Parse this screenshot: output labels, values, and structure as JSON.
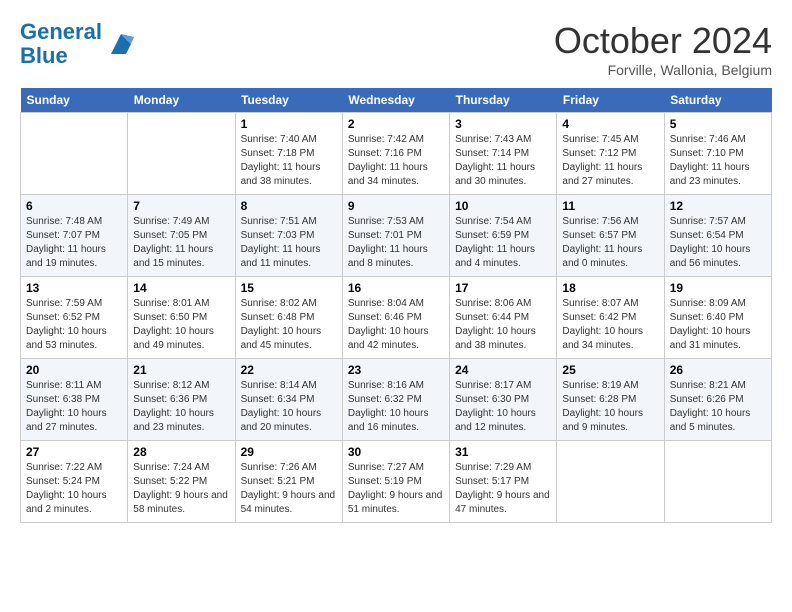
{
  "app": {
    "name": "GeneralBlue",
    "logo_color": "#1a6faf"
  },
  "title": "October 2024",
  "subtitle": "Forville, Wallonia, Belgium",
  "days_of_week": [
    "Sunday",
    "Monday",
    "Tuesday",
    "Wednesday",
    "Thursday",
    "Friday",
    "Saturday"
  ],
  "weeks": [
    [
      {
        "day": "",
        "sunrise": "",
        "sunset": "",
        "daylight": ""
      },
      {
        "day": "",
        "sunrise": "",
        "sunset": "",
        "daylight": ""
      },
      {
        "day": "1",
        "sunrise": "Sunrise: 7:40 AM",
        "sunset": "Sunset: 7:18 PM",
        "daylight": "Daylight: 11 hours and 38 minutes."
      },
      {
        "day": "2",
        "sunrise": "Sunrise: 7:42 AM",
        "sunset": "Sunset: 7:16 PM",
        "daylight": "Daylight: 11 hours and 34 minutes."
      },
      {
        "day": "3",
        "sunrise": "Sunrise: 7:43 AM",
        "sunset": "Sunset: 7:14 PM",
        "daylight": "Daylight: 11 hours and 30 minutes."
      },
      {
        "day": "4",
        "sunrise": "Sunrise: 7:45 AM",
        "sunset": "Sunset: 7:12 PM",
        "daylight": "Daylight: 11 hours and 27 minutes."
      },
      {
        "day": "5",
        "sunrise": "Sunrise: 7:46 AM",
        "sunset": "Sunset: 7:10 PM",
        "daylight": "Daylight: 11 hours and 23 minutes."
      }
    ],
    [
      {
        "day": "6",
        "sunrise": "Sunrise: 7:48 AM",
        "sunset": "Sunset: 7:07 PM",
        "daylight": "Daylight: 11 hours and 19 minutes."
      },
      {
        "day": "7",
        "sunrise": "Sunrise: 7:49 AM",
        "sunset": "Sunset: 7:05 PM",
        "daylight": "Daylight: 11 hours and 15 minutes."
      },
      {
        "day": "8",
        "sunrise": "Sunrise: 7:51 AM",
        "sunset": "Sunset: 7:03 PM",
        "daylight": "Daylight: 11 hours and 11 minutes."
      },
      {
        "day": "9",
        "sunrise": "Sunrise: 7:53 AM",
        "sunset": "Sunset: 7:01 PM",
        "daylight": "Daylight: 11 hours and 8 minutes."
      },
      {
        "day": "10",
        "sunrise": "Sunrise: 7:54 AM",
        "sunset": "Sunset: 6:59 PM",
        "daylight": "Daylight: 11 hours and 4 minutes."
      },
      {
        "day": "11",
        "sunrise": "Sunrise: 7:56 AM",
        "sunset": "Sunset: 6:57 PM",
        "daylight": "Daylight: 11 hours and 0 minutes."
      },
      {
        "day": "12",
        "sunrise": "Sunrise: 7:57 AM",
        "sunset": "Sunset: 6:54 PM",
        "daylight": "Daylight: 10 hours and 56 minutes."
      }
    ],
    [
      {
        "day": "13",
        "sunrise": "Sunrise: 7:59 AM",
        "sunset": "Sunset: 6:52 PM",
        "daylight": "Daylight: 10 hours and 53 minutes."
      },
      {
        "day": "14",
        "sunrise": "Sunrise: 8:01 AM",
        "sunset": "Sunset: 6:50 PM",
        "daylight": "Daylight: 10 hours and 49 minutes."
      },
      {
        "day": "15",
        "sunrise": "Sunrise: 8:02 AM",
        "sunset": "Sunset: 6:48 PM",
        "daylight": "Daylight: 10 hours and 45 minutes."
      },
      {
        "day": "16",
        "sunrise": "Sunrise: 8:04 AM",
        "sunset": "Sunset: 6:46 PM",
        "daylight": "Daylight: 10 hours and 42 minutes."
      },
      {
        "day": "17",
        "sunrise": "Sunrise: 8:06 AM",
        "sunset": "Sunset: 6:44 PM",
        "daylight": "Daylight: 10 hours and 38 minutes."
      },
      {
        "day": "18",
        "sunrise": "Sunrise: 8:07 AM",
        "sunset": "Sunset: 6:42 PM",
        "daylight": "Daylight: 10 hours and 34 minutes."
      },
      {
        "day": "19",
        "sunrise": "Sunrise: 8:09 AM",
        "sunset": "Sunset: 6:40 PM",
        "daylight": "Daylight: 10 hours and 31 minutes."
      }
    ],
    [
      {
        "day": "20",
        "sunrise": "Sunrise: 8:11 AM",
        "sunset": "Sunset: 6:38 PM",
        "daylight": "Daylight: 10 hours and 27 minutes."
      },
      {
        "day": "21",
        "sunrise": "Sunrise: 8:12 AM",
        "sunset": "Sunset: 6:36 PM",
        "daylight": "Daylight: 10 hours and 23 minutes."
      },
      {
        "day": "22",
        "sunrise": "Sunrise: 8:14 AM",
        "sunset": "Sunset: 6:34 PM",
        "daylight": "Daylight: 10 hours and 20 minutes."
      },
      {
        "day": "23",
        "sunrise": "Sunrise: 8:16 AM",
        "sunset": "Sunset: 6:32 PM",
        "daylight": "Daylight: 10 hours and 16 minutes."
      },
      {
        "day": "24",
        "sunrise": "Sunrise: 8:17 AM",
        "sunset": "Sunset: 6:30 PM",
        "daylight": "Daylight: 10 hours and 12 minutes."
      },
      {
        "day": "25",
        "sunrise": "Sunrise: 8:19 AM",
        "sunset": "Sunset: 6:28 PM",
        "daylight": "Daylight: 10 hours and 9 minutes."
      },
      {
        "day": "26",
        "sunrise": "Sunrise: 8:21 AM",
        "sunset": "Sunset: 6:26 PM",
        "daylight": "Daylight: 10 hours and 5 minutes."
      }
    ],
    [
      {
        "day": "27",
        "sunrise": "Sunrise: 7:22 AM",
        "sunset": "Sunset: 5:24 PM",
        "daylight": "Daylight: 10 hours and 2 minutes."
      },
      {
        "day": "28",
        "sunrise": "Sunrise: 7:24 AM",
        "sunset": "Sunset: 5:22 PM",
        "daylight": "Daylight: 9 hours and 58 minutes."
      },
      {
        "day": "29",
        "sunrise": "Sunrise: 7:26 AM",
        "sunset": "Sunset: 5:21 PM",
        "daylight": "Daylight: 9 hours and 54 minutes."
      },
      {
        "day": "30",
        "sunrise": "Sunrise: 7:27 AM",
        "sunset": "Sunset: 5:19 PM",
        "daylight": "Daylight: 9 hours and 51 minutes."
      },
      {
        "day": "31",
        "sunrise": "Sunrise: 7:29 AM",
        "sunset": "Sunset: 5:17 PM",
        "daylight": "Daylight: 9 hours and 47 minutes."
      },
      {
        "day": "",
        "sunrise": "",
        "sunset": "",
        "daylight": ""
      },
      {
        "day": "",
        "sunrise": "",
        "sunset": "",
        "daylight": ""
      }
    ]
  ]
}
